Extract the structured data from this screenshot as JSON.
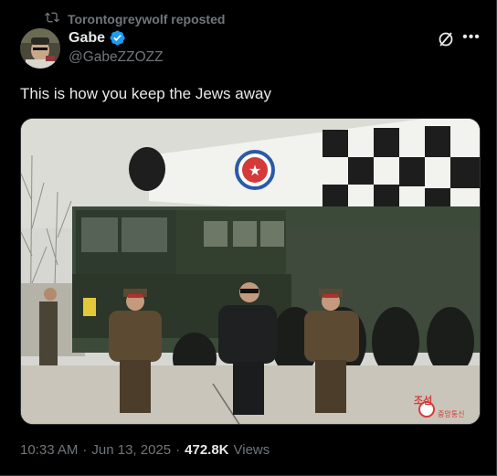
{
  "repost": {
    "label": "Torontogreywolf reposted",
    "icon": "repost-icon"
  },
  "author": {
    "display_name": "Gabe",
    "handle": "@GabeZZOZZ",
    "verified": true,
    "verified_color": "#1d9bf0"
  },
  "tweet": {
    "text": "This is how you keep the Jews away"
  },
  "media": {
    "watermark": "조선",
    "watermark_sub": "중앙통신",
    "missile_star": "★"
  },
  "meta": {
    "time": "10:33 AM",
    "separator": "·",
    "date": "Jun 13, 2025",
    "views_count": "472.8K",
    "views_label": "Views"
  },
  "colors": {
    "background": "#000000",
    "text": "#e7e9ea",
    "muted": "#71767b",
    "border": "#2f3336"
  }
}
